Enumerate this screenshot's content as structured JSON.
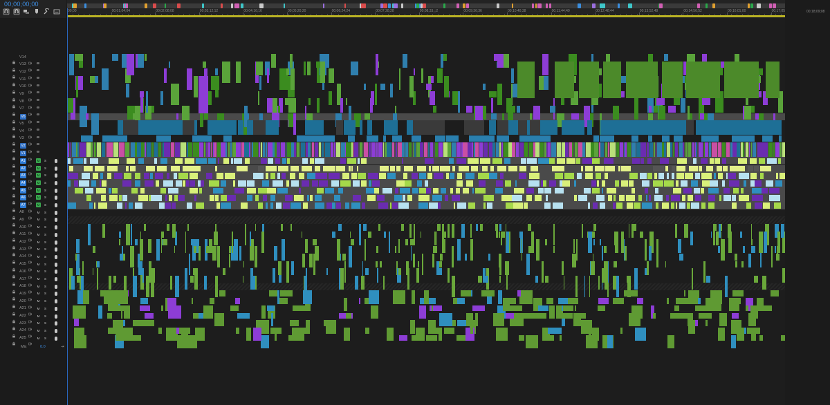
{
  "timecode": "00;00;00;00",
  "end_timecode": "00;18;09;08",
  "ruler_ticks": [
    "00;00",
    "00;01;04;04",
    "00;02;08;08",
    "00;03;12;12",
    "00;04;16;16",
    "00;05;20;20",
    "00;06;24;24",
    "00;07;28;28",
    "00;08;33;;;2",
    "00;09;36;36",
    "00;10;40;38",
    "00;11;44;40",
    "00;12;48;44",
    "00;13;52;48",
    "00;14;56;52",
    "00;16;01;00",
    "00;17;05;04"
  ],
  "tools": [
    "snap-icon",
    "linked-select-icon",
    "nest-icon",
    "marker-icon",
    "wrench-icon",
    "captions-icon"
  ],
  "video_tracks": [
    {
      "label": "V14",
      "targeted": false
    },
    {
      "label": "V13",
      "targeted": false
    },
    {
      "label": "V12",
      "targeted": false
    },
    {
      "label": "V11",
      "targeted": false
    },
    {
      "label": "V10",
      "targeted": false
    },
    {
      "label": "V9",
      "targeted": false
    },
    {
      "label": "V8",
      "targeted": false
    },
    {
      "label": "V7",
      "targeted": false
    },
    {
      "label": "V6",
      "targeted": true
    },
    {
      "label": "V5",
      "targeted": false
    },
    {
      "label": "V4",
      "targeted": false
    },
    {
      "label": "V3",
      "targeted": false
    },
    {
      "label": "V2",
      "targeted": true
    },
    {
      "label": "V1",
      "targeted": true
    }
  ],
  "audio_tracks": [
    {
      "label": "A1",
      "targeted": true
    },
    {
      "label": "A2",
      "targeted": true
    },
    {
      "label": "A3",
      "targeted": true
    },
    {
      "label": "A4",
      "targeted": true
    },
    {
      "label": "A5",
      "targeted": true
    },
    {
      "label": "A6",
      "targeted": true
    },
    {
      "label": "A7",
      "targeted": true
    },
    {
      "label": "A8",
      "targeted": false
    },
    {
      "label": "A9",
      "targeted": false
    },
    {
      "label": "A10",
      "targeted": false
    },
    {
      "label": "A11",
      "targeted": false
    },
    {
      "label": "A12",
      "targeted": false
    },
    {
      "label": "A13",
      "targeted": false
    },
    {
      "label": "A14",
      "targeted": false
    },
    {
      "label": "A15",
      "targeted": false
    },
    {
      "label": "A16",
      "targeted": false
    },
    {
      "label": "A17",
      "targeted": false
    },
    {
      "label": "A18",
      "targeted": false
    },
    {
      "label": "A19",
      "targeted": false
    },
    {
      "label": "A20",
      "targeted": false
    },
    {
      "label": "A21",
      "targeted": false
    },
    {
      "label": "A22",
      "targeted": false
    },
    {
      "label": "A23",
      "targeted": false
    },
    {
      "label": "A24",
      "targeted": false
    },
    {
      "label": "A25",
      "targeted": false
    }
  ],
  "mix": {
    "label": "Mix",
    "value": "0.0"
  },
  "mute_label": "M",
  "solo_label": "S",
  "colors": {
    "accent": "#2e7bd6",
    "audio_green": "#3aa84f",
    "work_area": "#b9b224"
  }
}
